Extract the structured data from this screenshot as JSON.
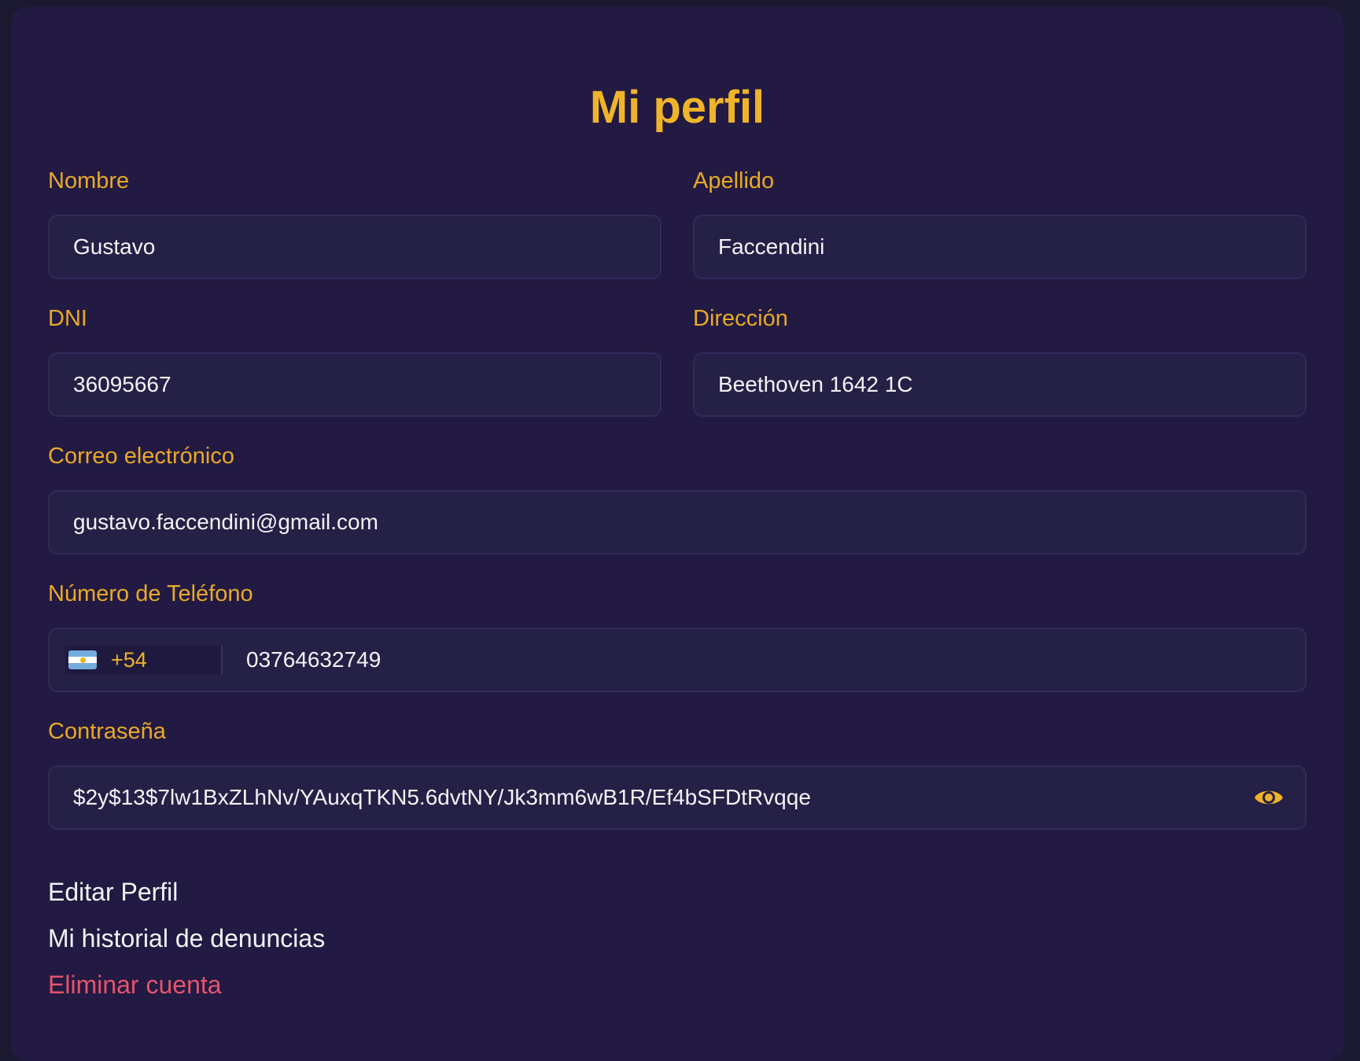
{
  "page": {
    "title": "Mi perfil"
  },
  "form": {
    "nombre": {
      "label": "Nombre",
      "value": "Gustavo"
    },
    "apellido": {
      "label": "Apellido",
      "value": "Faccendini"
    },
    "dni": {
      "label": "DNI",
      "value": "36095667"
    },
    "direccion": {
      "label": "Dirección",
      "value": "Beethoven 1642 1C"
    },
    "email": {
      "label": "Correo electrónico",
      "value": "gustavo.faccendini@gmail.com"
    },
    "telefono": {
      "label": "Número de Teléfono",
      "country_flag": "argentina-flag-icon",
      "country_code": "+54",
      "value": "03764632749"
    },
    "password": {
      "label": "Contraseña",
      "value": "$2y$13$7lw1BxZLhNv/YAuxqTKN5.6dvtNY/Jk3mm6wB1R/Ef4bSFDtRvqqe",
      "toggle_icon": "eye-icon"
    }
  },
  "actions": {
    "edit": "Editar Perfil",
    "history": "Mi historial de denuncias",
    "delete": "Eliminar cuenta"
  },
  "colors": {
    "background": "#221a42",
    "accent": "#f0b429",
    "label": "#e9a927",
    "text": "#f3f2f8",
    "danger": "#e5546b",
    "field_bg": "#252045",
    "field_border": "#322a5c"
  }
}
